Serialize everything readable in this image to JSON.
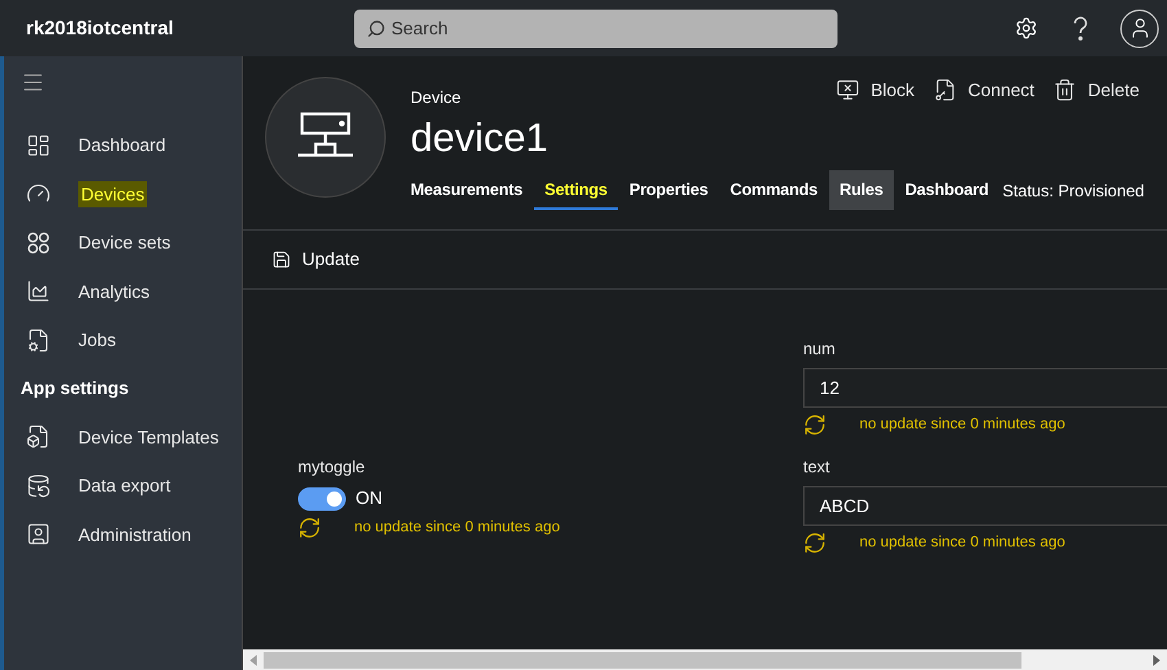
{
  "app": {
    "title": "rk2018iotcentral"
  },
  "search": {
    "placeholder": "Search"
  },
  "sidebar": {
    "items": [
      {
        "label": "Dashboard",
        "highlighted": false
      },
      {
        "label": "Devices",
        "highlighted": true
      },
      {
        "label": "Device sets",
        "highlighted": false
      },
      {
        "label": "Analytics",
        "highlighted": false
      },
      {
        "label": "Jobs",
        "highlighted": false
      }
    ],
    "section": "App settings",
    "settings_items": [
      {
        "label": "Device Templates",
        "highlighted": false
      },
      {
        "label": "Data export",
        "highlighted": false
      },
      {
        "label": "Administration",
        "highlighted": false
      }
    ]
  },
  "device": {
    "caption": "Device",
    "name": "device1",
    "status": "Status: Provisioned"
  },
  "actions": [
    {
      "label": "Block"
    },
    {
      "label": "Connect"
    },
    {
      "label": "Delete"
    }
  ],
  "tabs": [
    {
      "label": "Measurements",
      "selected": false,
      "hovered": false,
      "highlighted": false
    },
    {
      "label": "Settings",
      "selected": true,
      "hovered": false,
      "highlighted": true
    },
    {
      "label": "Properties",
      "selected": false,
      "hovered": false,
      "highlighted": false
    },
    {
      "label": "Commands",
      "selected": false,
      "hovered": false,
      "highlighted": false
    },
    {
      "label": "Rules",
      "selected": false,
      "hovered": true,
      "highlighted": false
    },
    {
      "label": "Dashboard",
      "selected": false,
      "hovered": false,
      "highlighted": false
    }
  ],
  "toolbar": {
    "update": "Update"
  },
  "settings": [
    {
      "kind": "field",
      "label": "num",
      "value": "12",
      "sync": "no update since 0 minutes ago"
    },
    {
      "kind": "toggle",
      "label": "mytoggle",
      "on": true,
      "value": "ON",
      "sync": "no update since 0 minutes ago"
    },
    {
      "kind": "field",
      "label": "text",
      "value": "ABCD",
      "sync": "no update since 0 minutes ago"
    }
  ]
}
